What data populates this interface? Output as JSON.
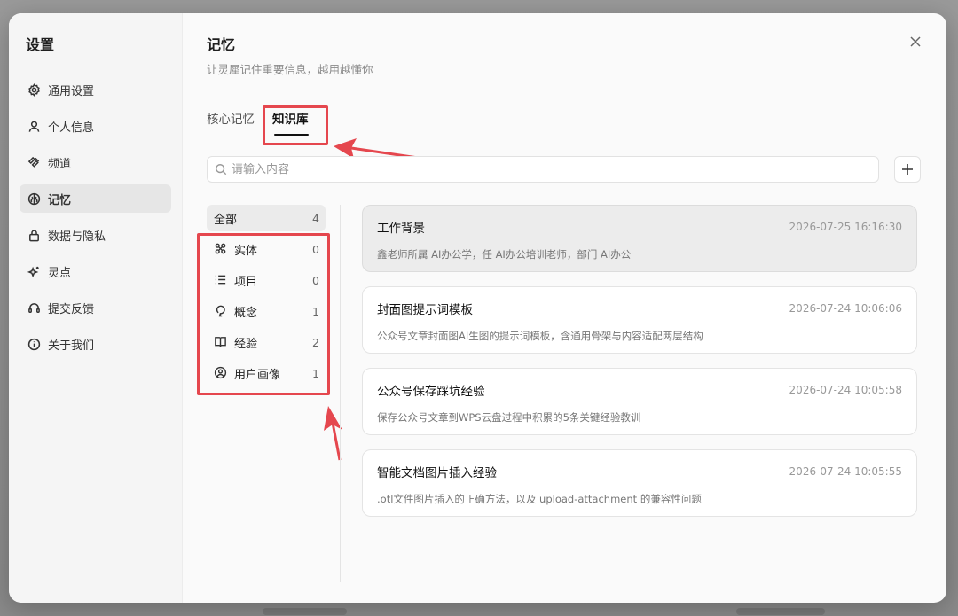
{
  "sidebar": {
    "title": "设置",
    "items": [
      {
        "label": "通用设置",
        "icon": "gear-icon",
        "active": false
      },
      {
        "label": "个人信息",
        "icon": "user-icon",
        "active": false
      },
      {
        "label": "频道",
        "icon": "channel-icon",
        "active": false
      },
      {
        "label": "记忆",
        "icon": "memory-icon",
        "active": true
      },
      {
        "label": "数据与隐私",
        "icon": "lock-icon",
        "active": false
      },
      {
        "label": "灵点",
        "icon": "sparkle-icon",
        "active": false
      },
      {
        "label": "提交反馈",
        "icon": "headset-icon",
        "active": false
      },
      {
        "label": "关于我们",
        "icon": "info-icon",
        "active": false
      }
    ]
  },
  "header": {
    "title": "记忆",
    "subtitle": "让灵犀记住重要信息，越用越懂你"
  },
  "tabs": [
    {
      "label": "核心记忆",
      "active": false
    },
    {
      "label": "知识库",
      "active": true
    }
  ],
  "search": {
    "placeholder": "请输入内容",
    "value": ""
  },
  "categories": [
    {
      "label": "全部",
      "count": "4",
      "icon": "",
      "active": true
    },
    {
      "label": "实体",
      "count": "0",
      "icon": "entity-icon",
      "active": false
    },
    {
      "label": "项目",
      "count": "0",
      "icon": "list-icon",
      "active": false
    },
    {
      "label": "概念",
      "count": "1",
      "icon": "bulb-icon",
      "active": false
    },
    {
      "label": "经验",
      "count": "2",
      "icon": "book-icon",
      "active": false
    },
    {
      "label": "用户画像",
      "count": "1",
      "icon": "user-circle-icon",
      "active": false
    }
  ],
  "entries": [
    {
      "title": "工作背景",
      "time": "2026-07-25 16:16:30",
      "desc": "鑫老师所属 AI办公学，任 AI办公培训老师，部门 AI办公",
      "active": true
    },
    {
      "title": "封面图提示词模板",
      "time": "2026-07-24 10:06:06",
      "desc": "公众号文章封面图AI生图的提示词模板，含通用骨架与内容适配两层结构",
      "active": false
    },
    {
      "title": "公众号保存踩坑经验",
      "time": "2026-07-24 10:05:58",
      "desc": "保存公众号文章到WPS云盘过程中积累的5条关键经验教训",
      "active": false
    },
    {
      "title": "智能文档图片插入经验",
      "time": "2026-07-24 10:05:55",
      "desc": ".otl文件图片插入的正确方法，以及 upload-attachment 的兼容性问题",
      "active": false
    }
  ],
  "colors": {
    "annotation": "#e5474e",
    "accent": "#111111"
  }
}
